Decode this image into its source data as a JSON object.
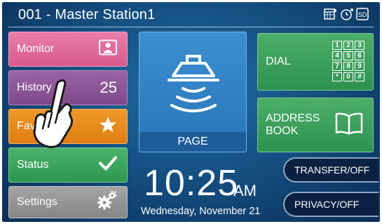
{
  "header": {
    "title": "001 - Master Station1",
    "icons": [
      "schedule-icon",
      "timer-icon",
      "sd-card-icon"
    ],
    "sd_label": "SD"
  },
  "left_buttons": {
    "monitor": {
      "label": "Monitor",
      "icon": "monitor-camera-icon"
    },
    "history": {
      "label": "History",
      "count": "25"
    },
    "favorites": {
      "label": "Favorites",
      "icon": "star-icon"
    },
    "status": {
      "label": "Status",
      "icon": "check-icon"
    },
    "settings": {
      "label": "Settings",
      "icon": "gears-icon"
    }
  },
  "page": {
    "label": "PAGE",
    "icon": "speaker-broadcast-icon"
  },
  "dial": {
    "label": "DIAL",
    "icon": "keypad-icon",
    "keys": [
      "1",
      "2",
      "3",
      "4",
      "5",
      "6",
      "7",
      "8",
      "9",
      "*",
      "0",
      "#"
    ]
  },
  "address_book": {
    "label_line1": "ADDRESS",
    "label_line2": "BOOK",
    "icon": "book-icon"
  },
  "clock": {
    "time": "10:25",
    "ampm": "AM",
    "date": "Wednesday, November 21"
  },
  "toggles": {
    "transfer": "TRANSFER/OFF",
    "privacy": "PRIVACY/OFF"
  },
  "colors": {
    "background": "#134a7c",
    "monitor": "#e06a99",
    "history": "#8d5797",
    "favorites": "#e88b1f",
    "status": "#3ca45d",
    "settings": "#959595",
    "page": "#3182c4",
    "dial": "#3ea05c"
  }
}
